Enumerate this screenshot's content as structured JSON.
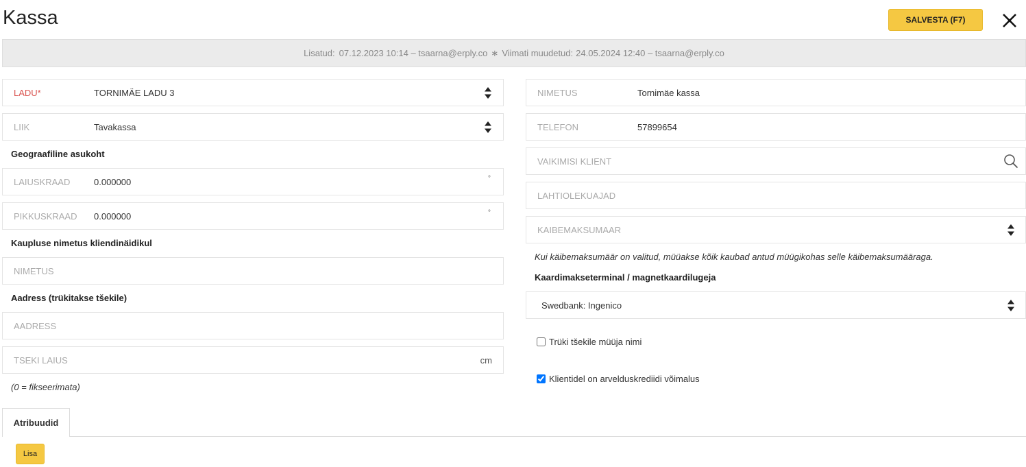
{
  "header": {
    "title": "Kassa",
    "save_label": "SALVESTA (F7)"
  },
  "meta": {
    "added_label": "Lisatud:",
    "added_value": "07.12.2023 10:14 – tsaarna@erply.co",
    "separator": "∗",
    "modified_label": "Viimati muudetud:",
    "modified_value": "24.05.2024 12:40 – tsaarna@erply.co"
  },
  "left": {
    "warehouse": {
      "label": "LADU*",
      "value": "TORNIMÄE LADU 3"
    },
    "type": {
      "label": "LIIK",
      "value": "Tavakassa"
    },
    "geo_heading": "Geograafiline asukoht",
    "latitude": {
      "label": "LAIUSKRAAD",
      "value": "0.000000",
      "unit": "°"
    },
    "longitude": {
      "label": "PIKKUSKRAAD",
      "value": "0.000000",
      "unit": "°"
    },
    "display_heading": "Kaupluse nimetus kliendinäidikul",
    "display_name": {
      "placeholder": "NIMETUS"
    },
    "address_heading": "Aadress (trükitakse tšekile)",
    "address": {
      "placeholder": "AADRESS"
    },
    "receipt_width": {
      "placeholder": "TSEKI LAIUS",
      "unit": "cm"
    },
    "receipt_hint": "(0 = fikseerimata)"
  },
  "right": {
    "name": {
      "label": "NIMETUS",
      "value": "Tornimäe kassa"
    },
    "phone": {
      "label": "TELEFON",
      "value": "57899654"
    },
    "default_client": {
      "placeholder": "VAIKIMISI KLIENT"
    },
    "opening_hours": {
      "placeholder": "LAHTIOLEKUAJAD"
    },
    "vat_rate": {
      "placeholder": "KAIBEMAKSUMAAR"
    },
    "vat_hint": "Kui käibemaksumäär on valitud, müüakse kõik kaubad antud müügikohas selle käibemaksumääraga.",
    "terminal_heading": "Kaardimakseterminal / magnetkaardilugeja",
    "terminal": {
      "value": "Swedbank: Ingenico"
    },
    "print_seller": {
      "label": "Trüki tšekile müüja nimi",
      "checked": false
    },
    "credit_allowed": {
      "label": "Klientidel on arvelduskrediidi võimalus",
      "checked": true
    }
  },
  "tabs": {
    "attributes": "Atribuudid",
    "add_label": "Lisa"
  }
}
